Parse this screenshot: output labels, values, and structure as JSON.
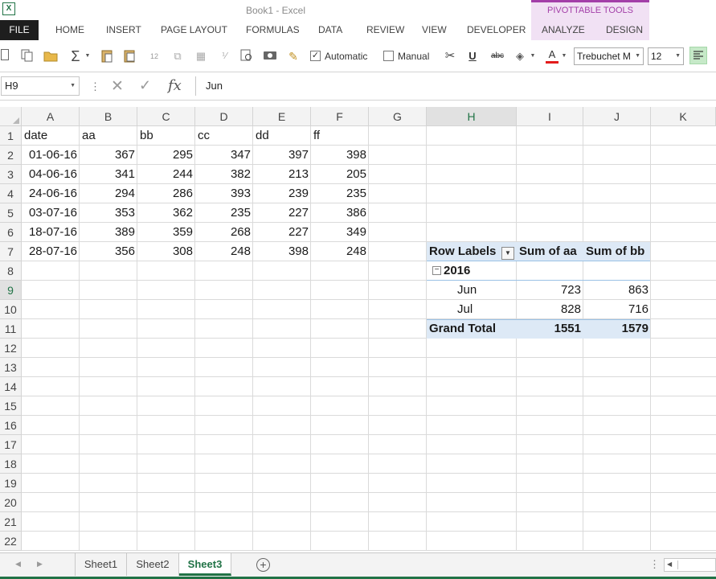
{
  "window": {
    "title": "Book1 - Excel",
    "context_group": "PIVOTTABLE TOOLS",
    "logo": "X"
  },
  "ribbon": {
    "file_tab": "FILE",
    "tabs": [
      "HOME",
      "INSERT",
      "PAGE LAYOUT",
      "FORMULAS",
      "DATA",
      "REVIEW",
      "VIEW",
      "DEVELOPER"
    ],
    "context_tabs": [
      "ANALYZE",
      "DESIGN"
    ]
  },
  "toolbar": {
    "automatic_label": "Automatic",
    "manual_label": "Manual",
    "automatic_checked": true,
    "manual_checked": false,
    "underline_glyph": "U",
    "strike_glyph": "abc",
    "font_color_glyph": "A",
    "font_color": "#e31b1b",
    "font_name": "Trebuchet M",
    "font_size": "12"
  },
  "formula_bar": {
    "name_box": "H9",
    "fx_label": "fx",
    "formula": "Jun"
  },
  "columns": [
    "A",
    "B",
    "C",
    "D",
    "E",
    "F",
    "G",
    "H",
    "I",
    "J",
    "K"
  ],
  "rows": [
    "1",
    "2",
    "3",
    "4",
    "5",
    "6",
    "7",
    "8",
    "9",
    "10",
    "11",
    "12",
    "13",
    "14",
    "15",
    "16",
    "17",
    "18",
    "19",
    "20",
    "21",
    "22"
  ],
  "sheet": {
    "headers": [
      "date",
      "aa",
      "bb",
      "cc",
      "dd",
      "ff"
    ],
    "data": [
      [
        "01-06-16",
        "367",
        "295",
        "347",
        "397",
        "398"
      ],
      [
        "04-06-16",
        "341",
        "244",
        "382",
        "213",
        "205"
      ],
      [
        "24-06-16",
        "294",
        "286",
        "393",
        "239",
        "235"
      ],
      [
        "03-07-16",
        "353",
        "362",
        "235",
        "227",
        "386"
      ],
      [
        "18-07-16",
        "389",
        "359",
        "268",
        "227",
        "349"
      ],
      [
        "28-07-16",
        "356",
        "308",
        "248",
        "398",
        "248"
      ]
    ]
  },
  "pivot": {
    "row_labels": "Row Labels",
    "col1": "Sum of aa",
    "col2": "Sum of bb",
    "year": "2016",
    "rows": [
      {
        "label": "Jun",
        "aa": "723",
        "bb": "863"
      },
      {
        "label": "Jul",
        "aa": "828",
        "bb": "716"
      }
    ],
    "grand_total_label": "Grand Total",
    "grand_total_aa": "1551",
    "grand_total_bb": "1579",
    "header_color": "#dde9f6"
  },
  "sheet_tabs": [
    "Sheet1",
    "Sheet2",
    "Sheet3"
  ],
  "active_sheet": "Sheet3",
  "colors": {
    "excel_green": "#217346",
    "pivot_accent": "#a33fa8"
  }
}
